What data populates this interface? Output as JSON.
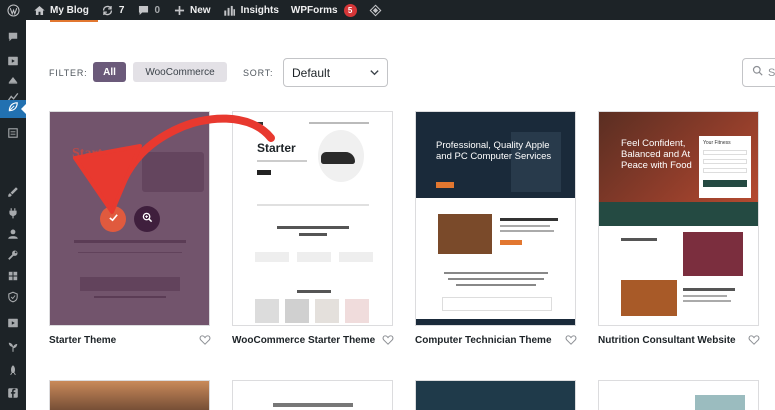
{
  "adminbar": {
    "site_name": "My Blog",
    "updates_count": "7",
    "comments_count": "0",
    "new_label": "New",
    "insights_label": "Insights",
    "wpforms_label": "WPForms",
    "wpforms_badge": "5"
  },
  "filters": {
    "filter_label": "FILTER:",
    "options": [
      "All",
      "WooCommerce"
    ],
    "active": "All",
    "sort_label": "SORT:",
    "sort_value": "Default",
    "search_placeholder": "Se"
  },
  "themes": [
    {
      "name": "Starter Theme",
      "preview_title": "Starter"
    },
    {
      "name": "WooCommerce Starter Theme",
      "preview_title": "Starter"
    },
    {
      "name": "Computer Technician Theme",
      "preview_title": "Professional, Quality Apple and PC Computer Services"
    },
    {
      "name": "Nutrition Consultant Website",
      "preview_title": "Feel Confident, Balanced and At Peace with Food",
      "form_title": "Your Fitness"
    }
  ],
  "colors": {
    "adminbar_bg": "#1d2327",
    "active_menu": "#2271b1",
    "filter_active": "#6b5a7a",
    "hover_overlay": "#583452",
    "check_button": "#e05a3e",
    "arrow": "#e8392f",
    "wpforms_badge": "#d63638"
  }
}
